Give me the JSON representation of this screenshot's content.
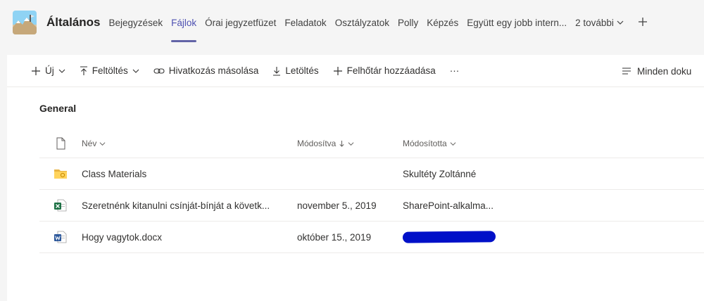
{
  "header": {
    "channel_title": "Általános",
    "tabs": [
      {
        "label": "Bejegyzések",
        "active": false
      },
      {
        "label": "Fájlok",
        "active": true
      },
      {
        "label": "Órai jegyzetfüzet",
        "active": false
      },
      {
        "label": "Feladatok",
        "active": false
      },
      {
        "label": "Osztályzatok",
        "active": false
      },
      {
        "label": "Polly",
        "active": false
      },
      {
        "label": "Képzés",
        "active": false
      },
      {
        "label": "Együtt egy jobb intern...",
        "active": false
      }
    ],
    "more_tabs_label": "2 további",
    "add_tab_icon": "plus-icon",
    "accent_color": "#6264a7"
  },
  "commandbar": {
    "new_label": "Új",
    "upload_label": "Feltöltés",
    "copy_link_label": "Hivatkozás másolása",
    "download_label": "Letöltés",
    "add_cloud_label": "Felhőtár hozzáadása",
    "more_label": "···",
    "view_label": "Minden doku"
  },
  "folder": {
    "title": "General"
  },
  "table": {
    "columns": {
      "name": "Név",
      "modified": "Módosítva",
      "modified_by": "Módosította"
    },
    "rows": [
      {
        "type": "folder",
        "name": "Class Materials",
        "modified": "",
        "modified_by": "Skultéty Zoltánné"
      },
      {
        "type": "excel",
        "name": "Szeretnénk kitanulni csínját-bínját a követk...",
        "modified": "november 5., 2019",
        "modified_by": "SharePoint-alkalma..."
      },
      {
        "type": "word",
        "name": "Hogy vagytok.docx",
        "modified": "október 15., 2019",
        "modified_by": ""
      }
    ]
  }
}
